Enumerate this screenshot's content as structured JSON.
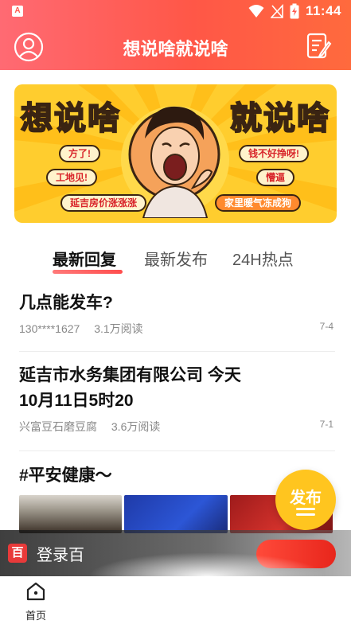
{
  "status_bar": {
    "app_badge": "A",
    "time": "11:44"
  },
  "header": {
    "title": "想说啥就说啥"
  },
  "banner": {
    "word_left": "想说啥",
    "word_right": "就说啥",
    "bubbles": [
      "方了!",
      "工地见!",
      "延吉房价涨涨涨",
      "钱不好挣呀!",
      "懵逼",
      "家里暖气冻成狗"
    ]
  },
  "tabs": [
    {
      "label": "最新回复",
      "active": true
    },
    {
      "label": "最新发布",
      "active": false
    },
    {
      "label": "24H热点",
      "active": false
    }
  ],
  "posts": [
    {
      "title": "几点能发车?",
      "author": "130****1627",
      "reads": "3.1万阅读",
      "date": "7-4"
    },
    {
      "title_line1": "延吉市水务集团有限公司 今天",
      "title_line2": "10月11日5时20",
      "author": "兴富豆石磨豆腐",
      "reads": "3.6万阅读",
      "date": "7-1"
    },
    {
      "title": "#平安健康～"
    }
  ],
  "fab": {
    "label": "发布"
  },
  "login_bar": {
    "logo": "百",
    "text": "登录百"
  },
  "bottom_nav": {
    "home_label": "首页"
  },
  "colors": {
    "header_gradient_start": "#ff6a73",
    "header_gradient_end": "#ff6a3d",
    "banner_yellow": "#ffcd2e",
    "fab_yellow": "#ffc51f",
    "login_red": "#e8261c"
  }
}
